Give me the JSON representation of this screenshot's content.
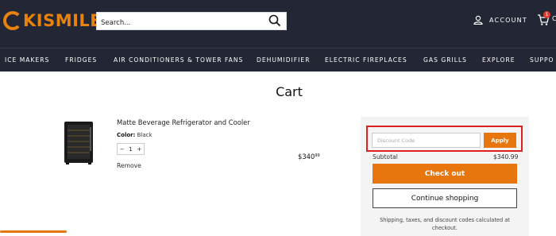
{
  "brand": {
    "logo_text": "KISMILE",
    "accent": "#e8820f",
    "header_bg": "#232634"
  },
  "search": {
    "placeholder": "Search..."
  },
  "header": {
    "account_label": "ACCOUNT",
    "cart_count": "1",
    "cart_tail": "C"
  },
  "nav": {
    "items": [
      "ICE MAKERS",
      "FRIDGES",
      "AIR CONDITIONERS & TOWER FANS",
      "DEHUMIDIFIER",
      "ELECTRIC FIREPLACES",
      "GAS GRILLS",
      "EXPLORE",
      "SUPPO"
    ]
  },
  "cart": {
    "title": "Cart",
    "item": {
      "name": "Matte Beverage Refrigerator and Cooler",
      "color_label": "Color:",
      "color_value": "Black",
      "qty_minus": "−",
      "qty_value": "1",
      "qty_plus": "+",
      "remove_label": "Remove",
      "price_main": "$340",
      "price_cents": "99"
    }
  },
  "summary": {
    "discount_placeholder": "Discount Code",
    "apply_label": "Apply",
    "subtotal_label": "Subtotal",
    "subtotal_value": "$340.99",
    "checkout_label": "Check out",
    "continue_label": "Continue shopping",
    "note": "Shipping, taxes, and discount codes calculated at checkout."
  }
}
